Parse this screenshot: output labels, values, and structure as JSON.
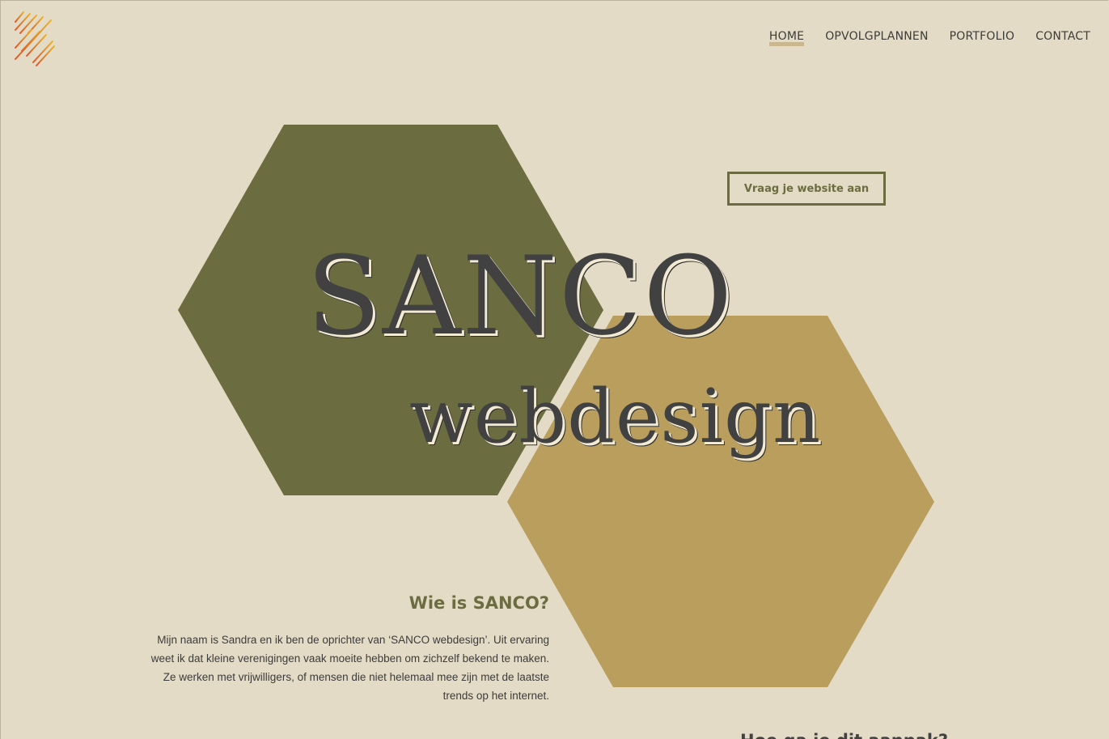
{
  "nav": {
    "items": [
      {
        "label": "HOME",
        "active": true
      },
      {
        "label": "OPVOLGPLANNEN",
        "active": false
      },
      {
        "label": "PORTFOLIO",
        "active": false
      },
      {
        "label": "CONTACT",
        "active": false
      }
    ]
  },
  "hero": {
    "title": "SANCO",
    "subtitle": "webdesign",
    "cta_label": "Vraag je website aan"
  },
  "about": {
    "heading": "Wie is SANCO?",
    "text": "Mijn naam is Sandra en ik ben de oprichter van ‘SANCO webdesign’. Uit ervaring weet ik dat kleine verenigingen vaak moeite hebben om zichzelf bekend te maken. Ze werken met vrijwilligers, of mensen die niet helemaal mee zijn met de laatste trends op het internet."
  },
  "next_section": {
    "heading": "Hoe ga je dit aanpak?"
  },
  "colors": {
    "background": "#e3dbc6",
    "olive": "#6b6d40",
    "gold": "#b99e5e",
    "text_dark": "#414141",
    "nav_underline": "#cbb78d",
    "logo_yellow": "#e8b12b",
    "logo_orange": "#d9572a"
  },
  "icons": {
    "logo": "diagonal-stripes-logo-icon"
  }
}
